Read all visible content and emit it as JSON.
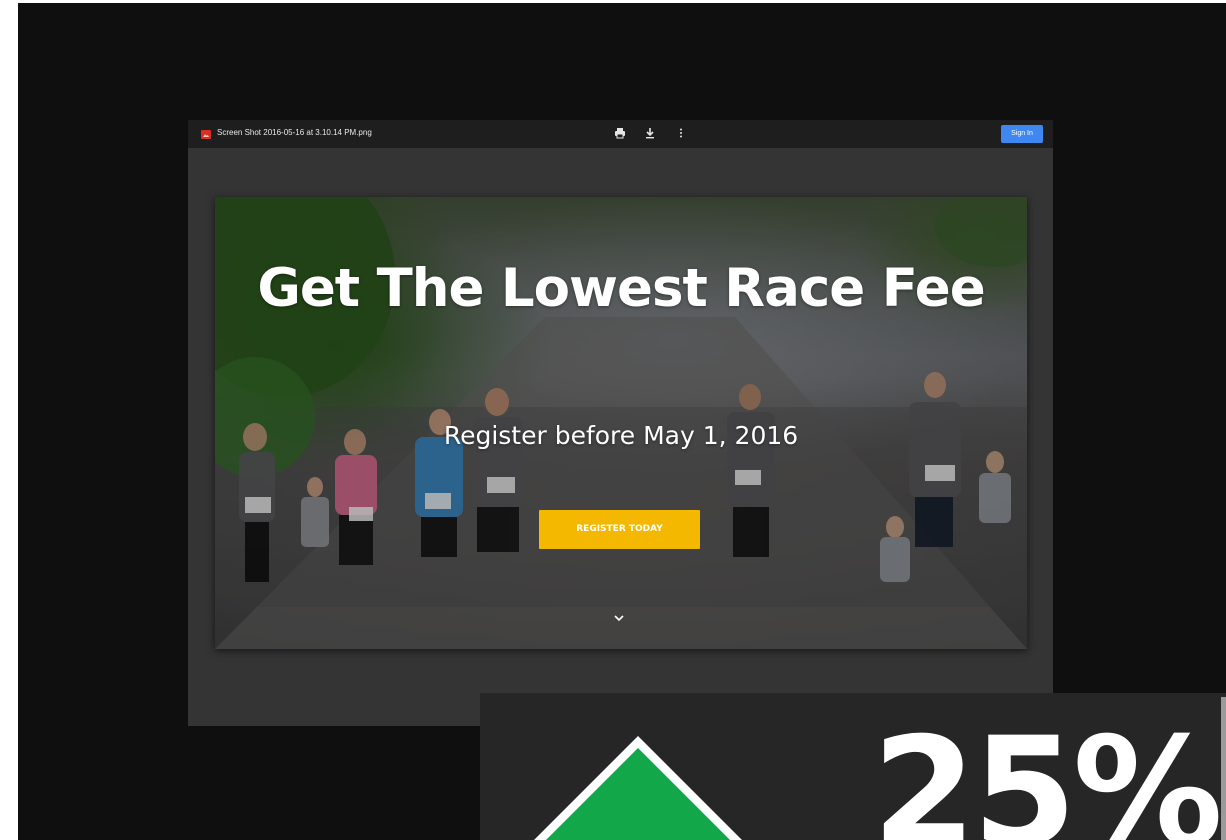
{
  "viewer": {
    "file_name": "Screen Shot 2016-05-16 at 3.10.14 PM.png",
    "icons": {
      "file": "image-file-icon",
      "print": "print-icon",
      "download": "download-icon",
      "more": "more-vertical-icon"
    },
    "sign_in_label": "Sign In",
    "sign_in_color": "#3f88f2"
  },
  "hero": {
    "title": "Get The Lowest Race Fee",
    "subtitle": "Register before May 1, 2016",
    "cta_label": "REGISTER TODAY",
    "cta_color": "#f5b800",
    "scroll_icon": "chevron-down-icon"
  },
  "promo": {
    "discount": "25%",
    "diamond_color": "#12a84a"
  }
}
